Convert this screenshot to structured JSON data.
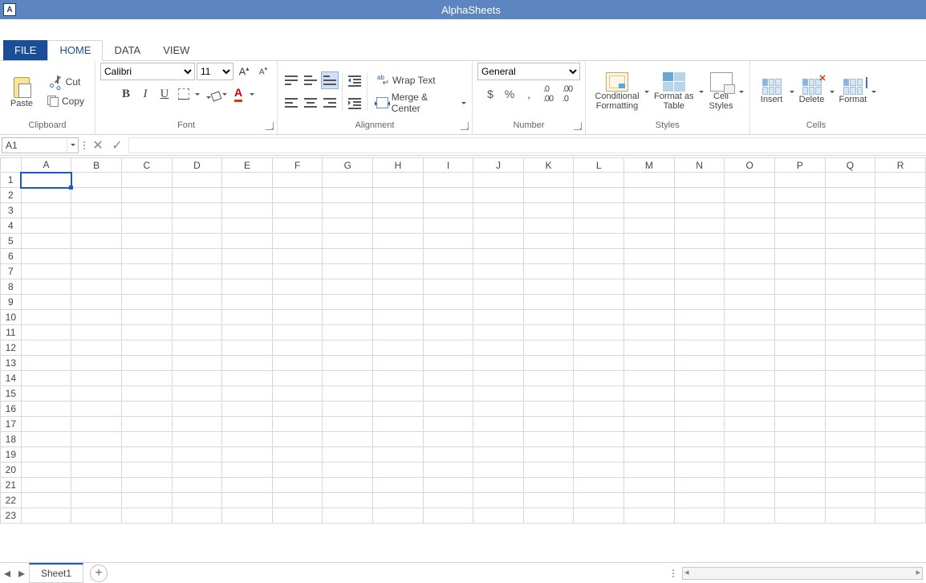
{
  "app": {
    "title": "AlphaSheets"
  },
  "tabs": {
    "file": "FILE",
    "home": "HOME",
    "data": "DATA",
    "view": "VIEW"
  },
  "ribbon": {
    "clipboard": {
      "label": "Clipboard",
      "paste": "Paste",
      "cut": "Cut",
      "copy": "Copy"
    },
    "font": {
      "label": "Font",
      "name": "Calibri",
      "size": "11"
    },
    "alignment": {
      "label": "Alignment",
      "wrap": "Wrap Text",
      "merge": "Merge &  Center"
    },
    "number": {
      "label": "Number",
      "format": "General"
    },
    "styles": {
      "label": "Styles",
      "cf1": "Conditional",
      "cf2": "Formatting",
      "fat1": "Format as",
      "fat2": "Table",
      "cs1": "Cell",
      "cs2": "Styles"
    },
    "cells": {
      "label": "Cells",
      "insert": "Insert",
      "delete": "Delete",
      "format": "Format"
    }
  },
  "fx": {
    "ref": "A1",
    "value": ""
  },
  "grid": {
    "cols": [
      "A",
      "B",
      "C",
      "D",
      "E",
      "F",
      "G",
      "H",
      "I",
      "J",
      "K",
      "L",
      "M",
      "N",
      "O",
      "P",
      "Q",
      "R"
    ],
    "rows": [
      1,
      2,
      3,
      4,
      5,
      6,
      7,
      8,
      9,
      10,
      11,
      12,
      13,
      14,
      15,
      16,
      17,
      18,
      19,
      20,
      21,
      22,
      23
    ],
    "sel": {
      "col": "A",
      "row": 1
    }
  },
  "sheets": {
    "active": "Sheet1"
  }
}
